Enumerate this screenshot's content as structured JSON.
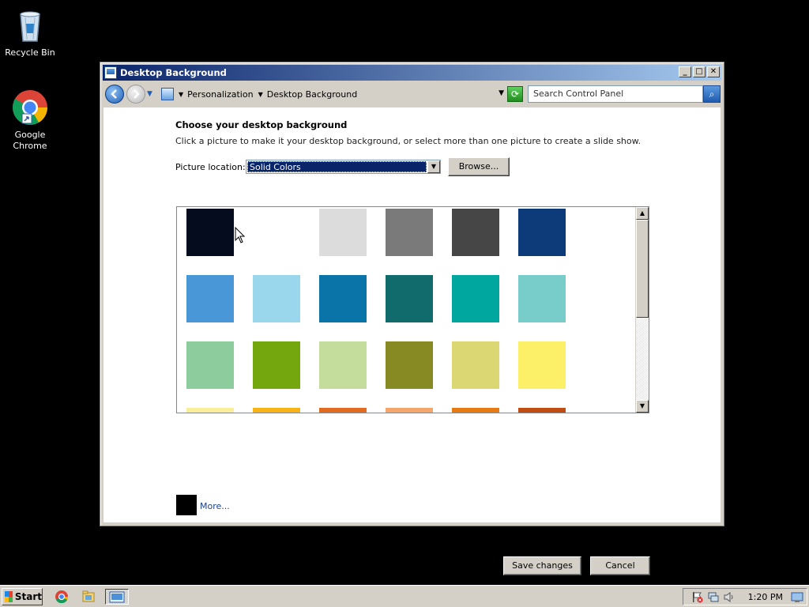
{
  "desktop": {
    "icons": [
      {
        "label": "Recycle Bin",
        "icon": "recycle-bin-icon"
      },
      {
        "label": "Google Chrome",
        "icon": "chrome-icon"
      }
    ]
  },
  "window": {
    "title": "Desktop Background",
    "controls": {
      "minimize": "_",
      "maximize": "□",
      "close": "✕"
    },
    "breadcrumbs": [
      "Personalization",
      "Desktop Background"
    ],
    "search_placeholder": "Search Control Panel"
  },
  "content": {
    "heading": "Choose your desktop background",
    "subtext": "Click a picture to make it your desktop background, or select more than one picture to create a slide show.",
    "picture_location_label": "Picture location:",
    "picture_location_value": "Solid Colors",
    "browse_label": "Browse...",
    "more_label": "More...",
    "save_label": "Save changes",
    "cancel_label": "Cancel"
  },
  "swatches": [
    [
      "#050c1e",
      "#ffffff",
      "#dcdcdc",
      "#7a7a7a",
      "#464646",
      "#0d3a78"
    ],
    [
      "#4a97d7",
      "#9ad6ec",
      "#0a74a8",
      "#116a6c",
      "#00a79e",
      "#78ccc9"
    ],
    [
      "#8ccc9d",
      "#74a60e",
      "#c5dd9c",
      "#878a22",
      "#dbd874",
      "#fcf069"
    ],
    [
      "#f9ee9a",
      "#f7b318",
      "#e06b21",
      "#f5a66a",
      "#e67a13",
      "#c04d13"
    ]
  ],
  "colors": {
    "title_gradient_start": "#0a246a",
    "title_gradient_end": "#a6caf0",
    "selected_blue": "#0a246a",
    "more_swatch": "#000000"
  },
  "taskbar": {
    "start_label": "Start",
    "clock": "1:20 PM"
  }
}
